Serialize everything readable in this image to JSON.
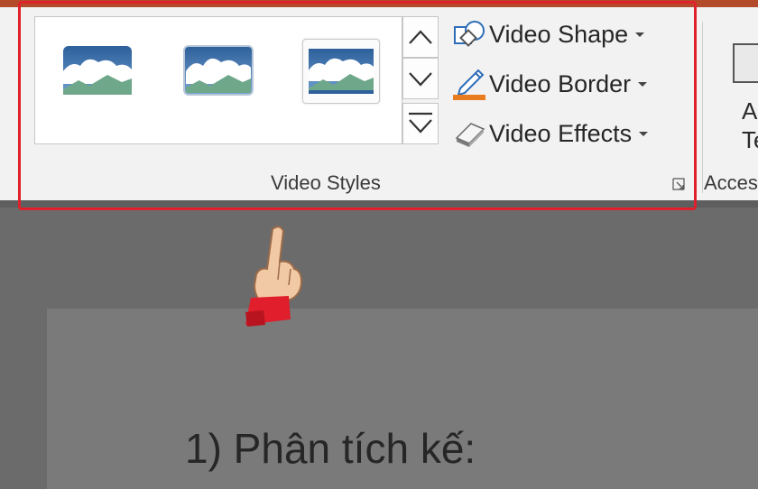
{
  "ribbon": {
    "video_styles_group": {
      "label": "Video Styles",
      "gallery": {
        "thumbnails": [
          {
            "name": "style-1",
            "selected": false
          },
          {
            "name": "style-2",
            "selected": false
          },
          {
            "name": "style-3",
            "selected": true
          }
        ]
      },
      "commands": {
        "video_shape": {
          "label": "Video Shape",
          "icon": "shape-icon"
        },
        "video_border": {
          "label": "Video Border",
          "icon": "pencil-icon",
          "accent": "#e87c1e"
        },
        "video_effects": {
          "label": "Video Effects",
          "icon": "eraser-icon"
        }
      }
    },
    "next_group": {
      "label": "Acces",
      "button_chars": [
        "A",
        "Te"
      ]
    }
  },
  "slide": {
    "text": "1) Phân tích kế:"
  },
  "colors": {
    "highlight": "#e0202a",
    "ribbon_bg": "#f2f2f2",
    "workspace": "#6b6b6b",
    "thumb_blue": "#3a6ea5",
    "thumb_green": "#6fa78b"
  }
}
